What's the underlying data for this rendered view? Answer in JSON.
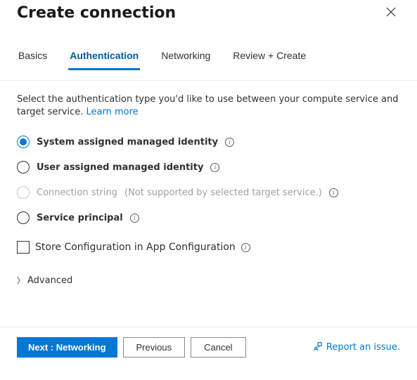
{
  "header": {
    "title": "Create connection"
  },
  "tabs": [
    {
      "label": "Basics",
      "active": false
    },
    {
      "label": "Authentication",
      "active": true
    },
    {
      "label": "Networking",
      "active": false
    },
    {
      "label": "Review + Create",
      "active": false
    }
  ],
  "description": {
    "text": "Select the authentication type you'd like to use between your compute service and target service. ",
    "link": "Learn more"
  },
  "auth_options": [
    {
      "label": "System assigned managed identity",
      "state": "checked"
    },
    {
      "label": "User assigned managed identity",
      "state": "unchecked"
    },
    {
      "label": "Connection string",
      "note": "(Not supported by selected target service.)",
      "state": "disabled"
    },
    {
      "label": "Service principal",
      "state": "unchecked"
    }
  ],
  "store_config": {
    "label": "Store Configuration in App Configuration",
    "checked": false
  },
  "advanced": {
    "label": "Advanced"
  },
  "footer": {
    "next": "Next : Networking",
    "previous": "Previous",
    "cancel": "Cancel",
    "report": "Report an issue."
  }
}
